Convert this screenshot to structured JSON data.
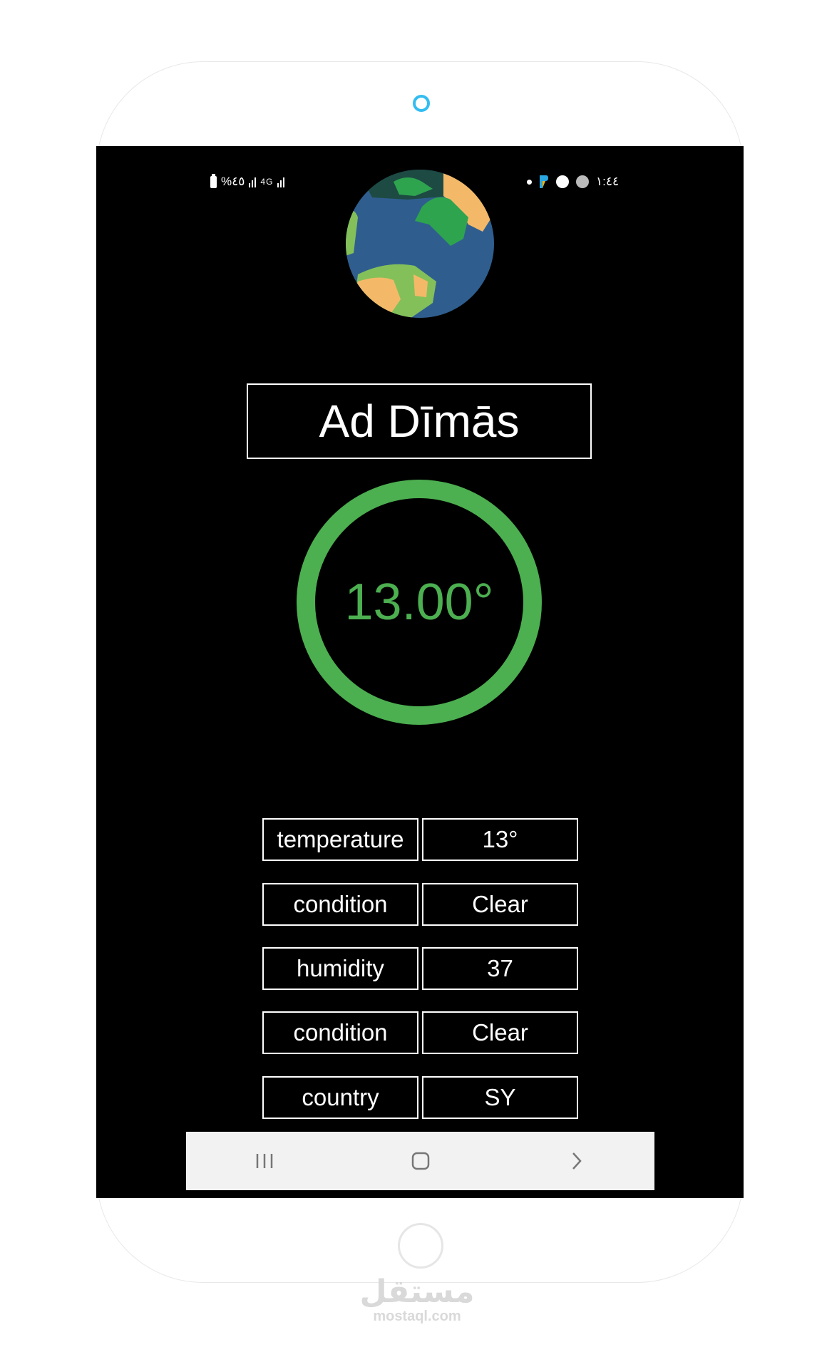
{
  "status_bar": {
    "left_text": "%٤٥",
    "network": "4G",
    "time": "١:٤٤"
  },
  "city": {
    "name": "Ad Dīmās"
  },
  "temperature_display": {
    "value": "13.00°"
  },
  "details": [
    {
      "key": "temperature",
      "value": "13°"
    },
    {
      "key": "condition",
      "value": "Clear"
    },
    {
      "key": "humidity",
      "value": "37"
    },
    {
      "key": "condition",
      "value": "Clear"
    },
    {
      "key": "country",
      "value": "SY"
    }
  ],
  "nav_icons": [
    "recent-apps-icon",
    "home-icon",
    "back-icon"
  ],
  "watermark": {
    "arabic": "مستقل",
    "latin": "mostaql.com"
  },
  "colors": {
    "accent": "#4caf50",
    "background": "#000000",
    "camera": "#33bdf0"
  }
}
